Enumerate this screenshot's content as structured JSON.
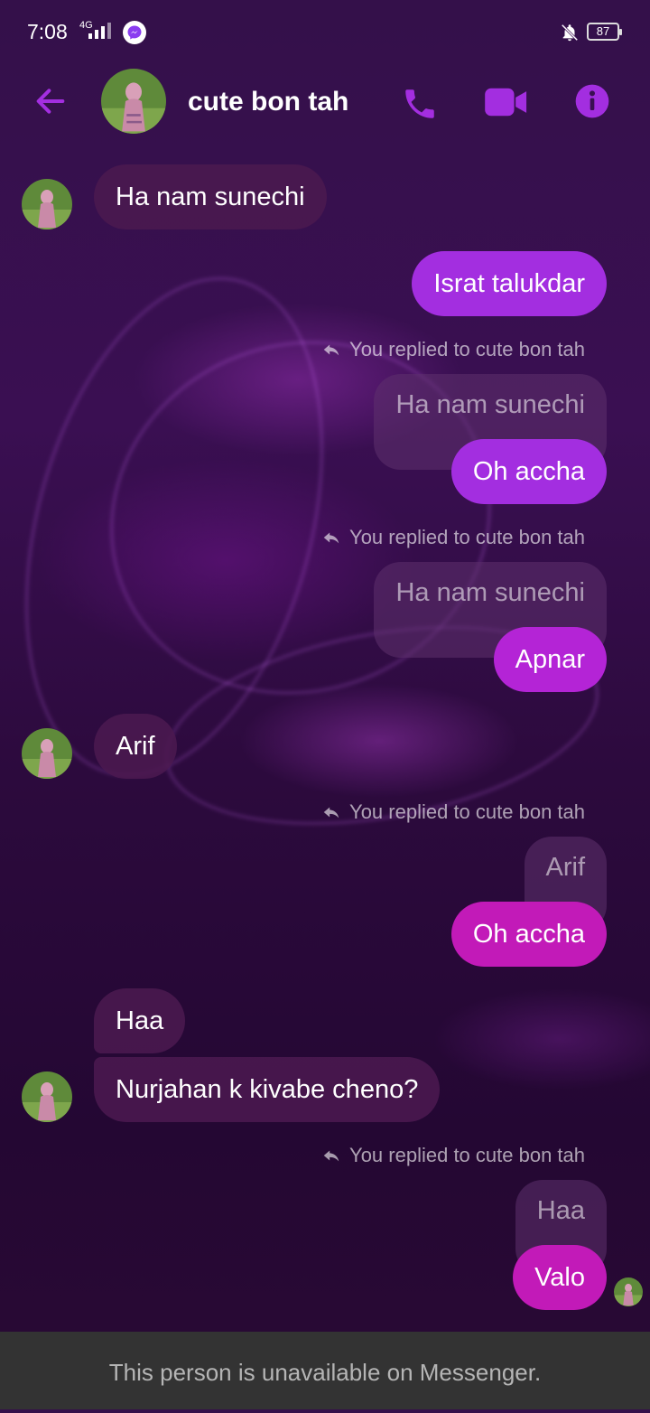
{
  "status_bar": {
    "time": "7:08",
    "network": "4G",
    "battery": "87"
  },
  "header": {
    "title": "cute bon tah"
  },
  "reply_note_text": "You replied to cute bon tah",
  "messages": {
    "m1": "Ha nam sunechi",
    "m2": "Israt talukdar",
    "q3": "Ha nam sunechi",
    "m3": "Oh accha",
    "q4": "Ha nam sunechi",
    "m4": "Apnar",
    "m5": "Arif",
    "q6": "Arif",
    "m6": "Oh accha",
    "m7": "Haa",
    "m8": "Nurjahan k kivabe cheno?",
    "q9": "Haa",
    "m9": "Valo"
  },
  "footer": {
    "text": "This person is unavailable on Messenger."
  },
  "colors": {
    "accent": "#a32ee0",
    "incoming_bubble": "#4b1950",
    "footer_bg": "#333333"
  }
}
